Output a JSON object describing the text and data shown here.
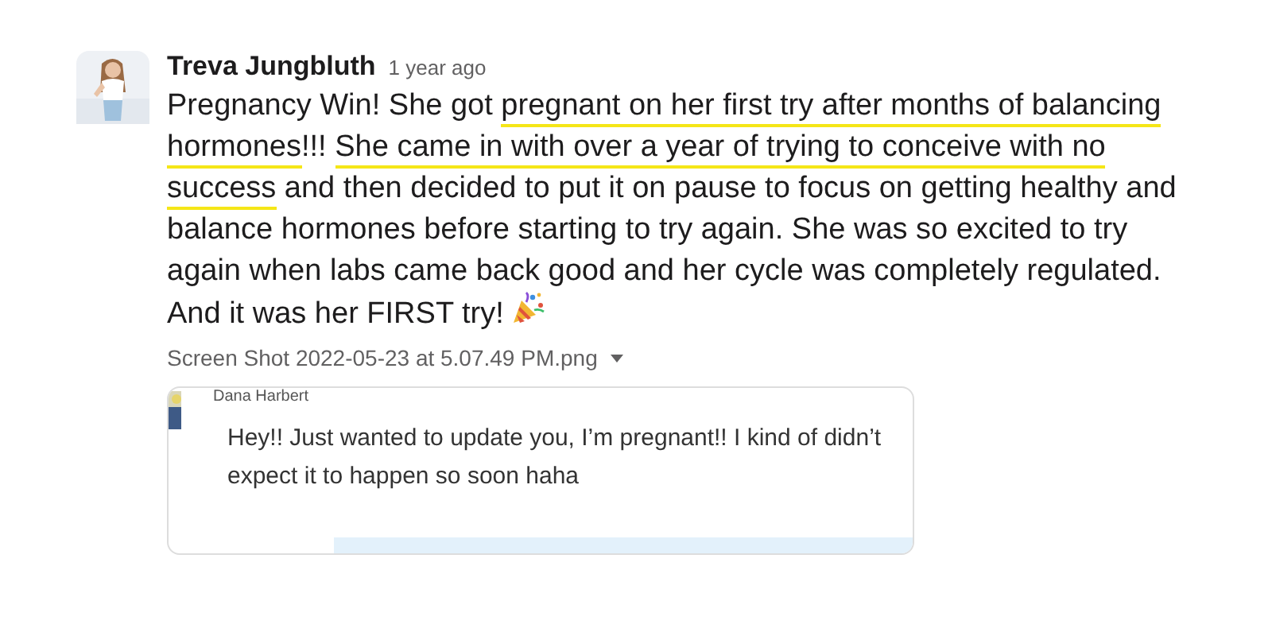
{
  "post": {
    "author": "Treva Jungbluth",
    "time": "1 year ago",
    "message": [
      {
        "text": "Pregnancy Win! She got ",
        "highlighted": false
      },
      {
        "text": "pregnant on her first try after months of balancing hormones",
        "highlighted": true
      },
      {
        "text": "!!! ",
        "highlighted": false
      },
      {
        "text": "She came in with over a year of trying to conceive with no success",
        "highlighted": true
      },
      {
        "text": " and then decided to put it on pause to focus on getting healthy and balance hormones before starting to try again. She was so excited to try again when labs came back good and her cycle was completely regulated. And it was her FIRST try!",
        "highlighted": false
      }
    ],
    "attachment": {
      "filename": "Screen Shot 2022-05-23 at 5.07.49 PM.png",
      "quoted_author": "Dana Harbert",
      "quoted_message": "Hey!! Just wanted to update you, I’m pregnant!! I kind of didn’t expect it to happen so soon haha"
    }
  }
}
